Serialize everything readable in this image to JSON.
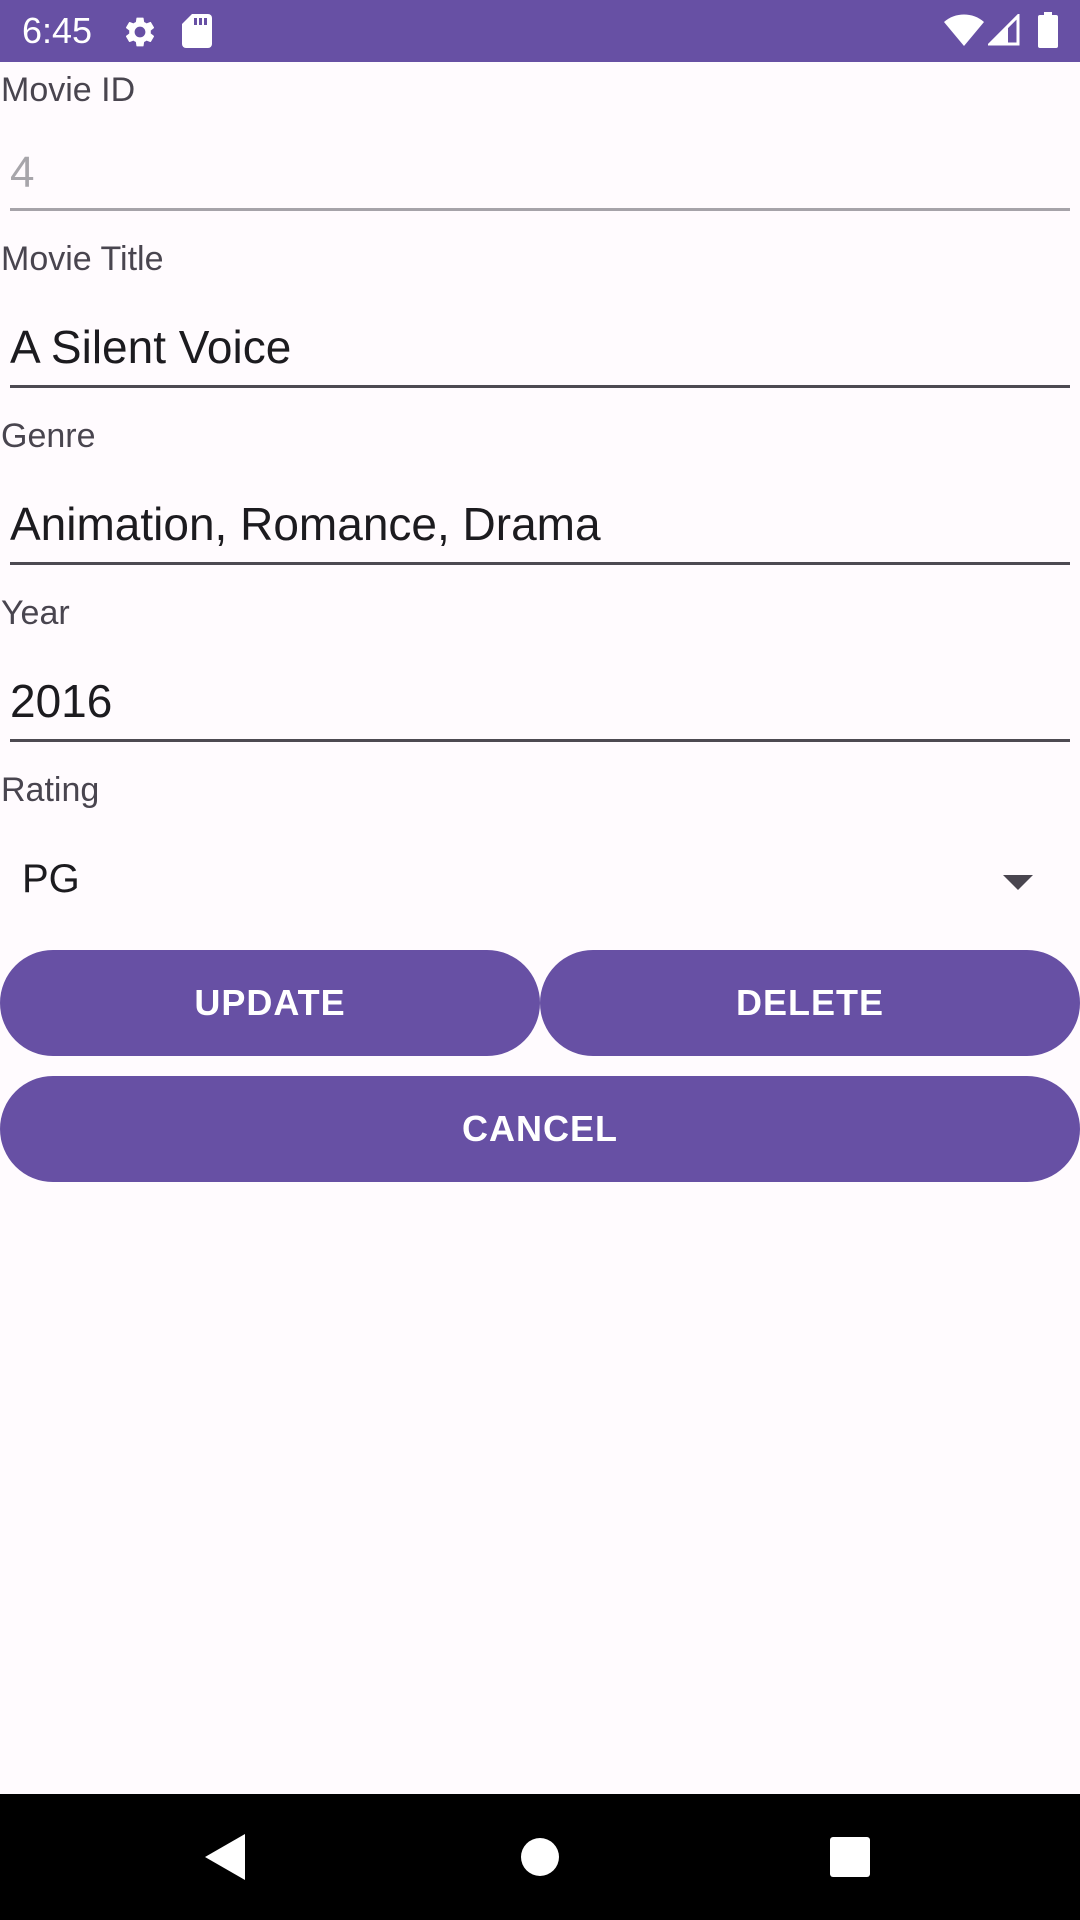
{
  "status_bar": {
    "time": "6:45",
    "background": "#6750A4",
    "icons": [
      "settings-icon",
      "sd-card-icon",
      "wifi-icon",
      "cell-signal-icon",
      "battery-icon"
    ]
  },
  "form": {
    "movie_id": {
      "label": "Movie ID",
      "value": "4",
      "enabled": false
    },
    "movie_title": {
      "label": "Movie Title",
      "value": "A Silent Voice"
    },
    "genre": {
      "label": "Genre",
      "value": "Animation, Romance, Drama"
    },
    "year": {
      "label": "Year",
      "value": "2016"
    },
    "rating": {
      "label": "Rating",
      "selected": "PG"
    }
  },
  "actions": {
    "update": "UPDATE",
    "delete": "DELETE",
    "cancel": "CANCEL",
    "button_color": "#6750A4"
  },
  "nav_bar": {
    "icons": [
      "back-icon",
      "home-icon",
      "recents-icon"
    ]
  }
}
